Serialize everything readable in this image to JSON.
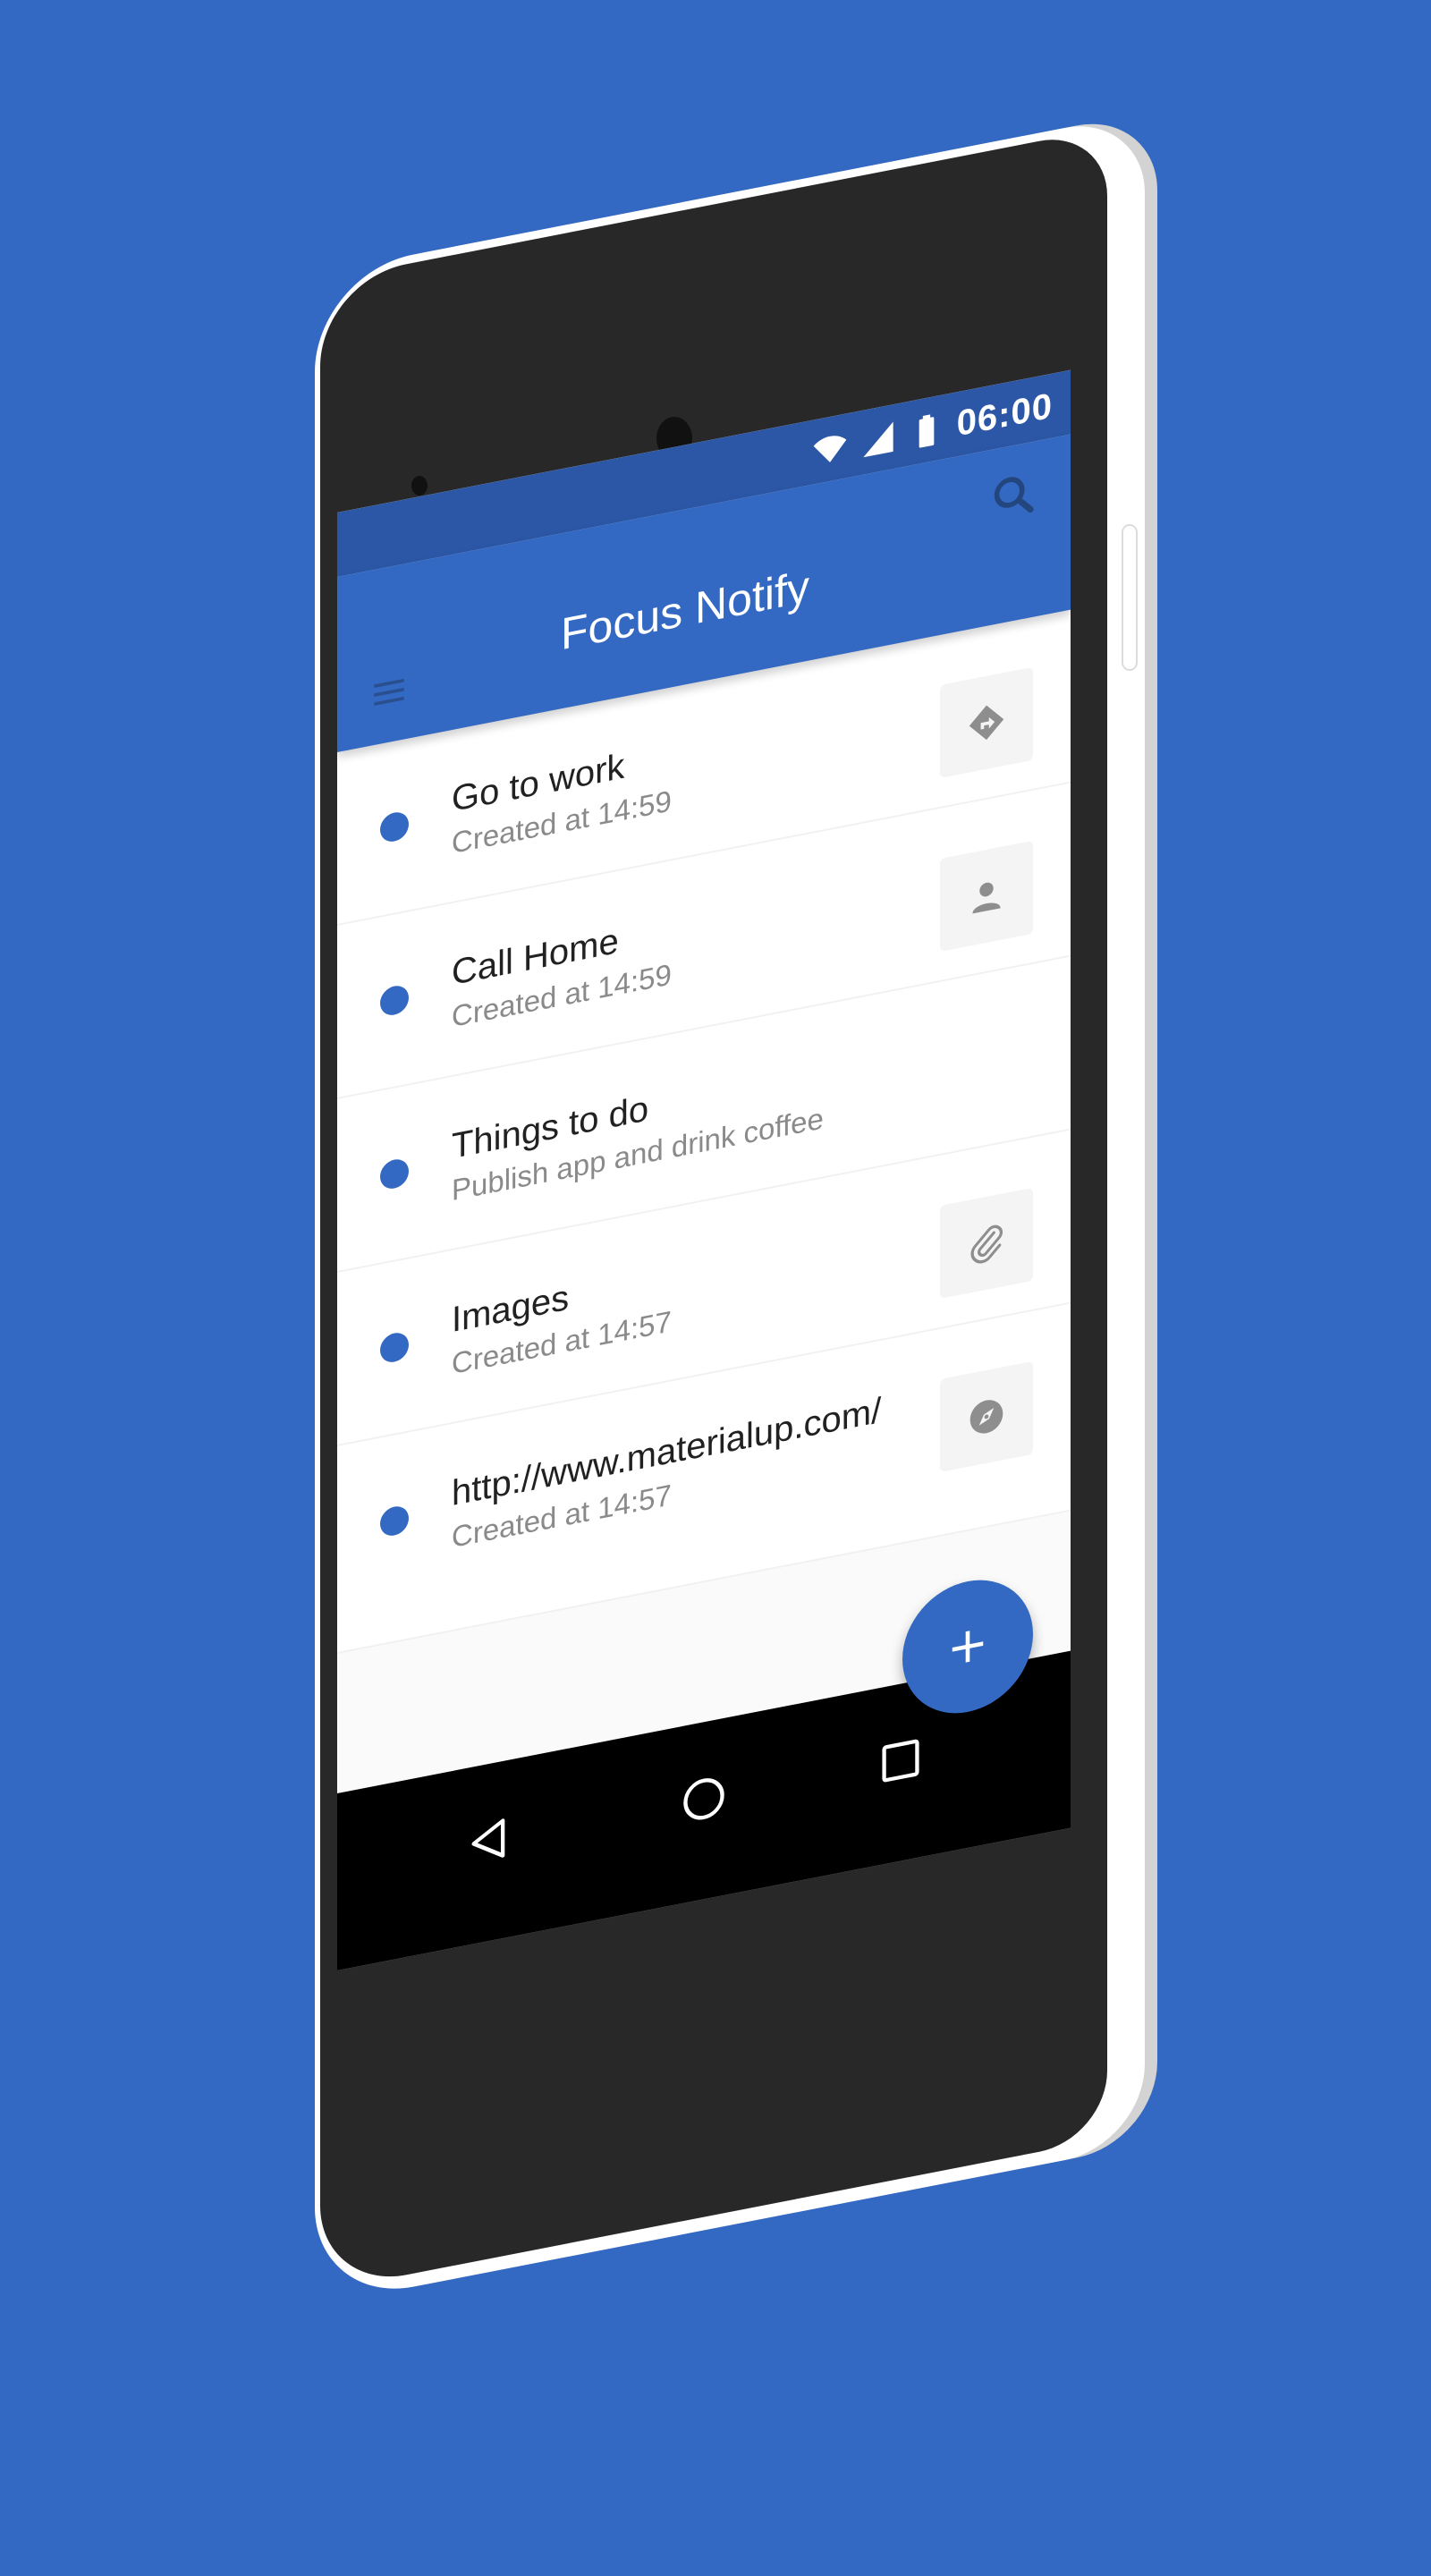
{
  "colors": {
    "background": "#3369c3",
    "accent": "#3369c3",
    "status_bar": "#2b57a6",
    "nav_bar": "#000000"
  },
  "status_bar": {
    "time": "06:00",
    "icons": [
      "wifi-icon",
      "signal-icon",
      "battery-icon"
    ]
  },
  "app_bar": {
    "title": "Focus Notify",
    "menu_icon": "menu-icon",
    "search_icon": "search-icon"
  },
  "notes": [
    {
      "title": "Go to work",
      "subtitle": "Created at 14:59",
      "action_icon": "directions-icon"
    },
    {
      "title": "Call Home",
      "subtitle": "Created at 14:59",
      "action_icon": "person-icon"
    },
    {
      "title": "Things to do",
      "subtitle": "Publish app and drink coffee",
      "action_icon": ""
    },
    {
      "title": "Images",
      "subtitle": "Created at 14:57",
      "action_icon": "paperclip-icon"
    },
    {
      "title": "http://www.materialup.com/",
      "subtitle": "Created at 14:57",
      "action_icon": "compass-icon"
    }
  ],
  "fab": {
    "label": "+",
    "icon": "plus-icon"
  },
  "nav_bar": {
    "icons": [
      "back-icon",
      "home-icon",
      "recent-apps-icon"
    ]
  }
}
